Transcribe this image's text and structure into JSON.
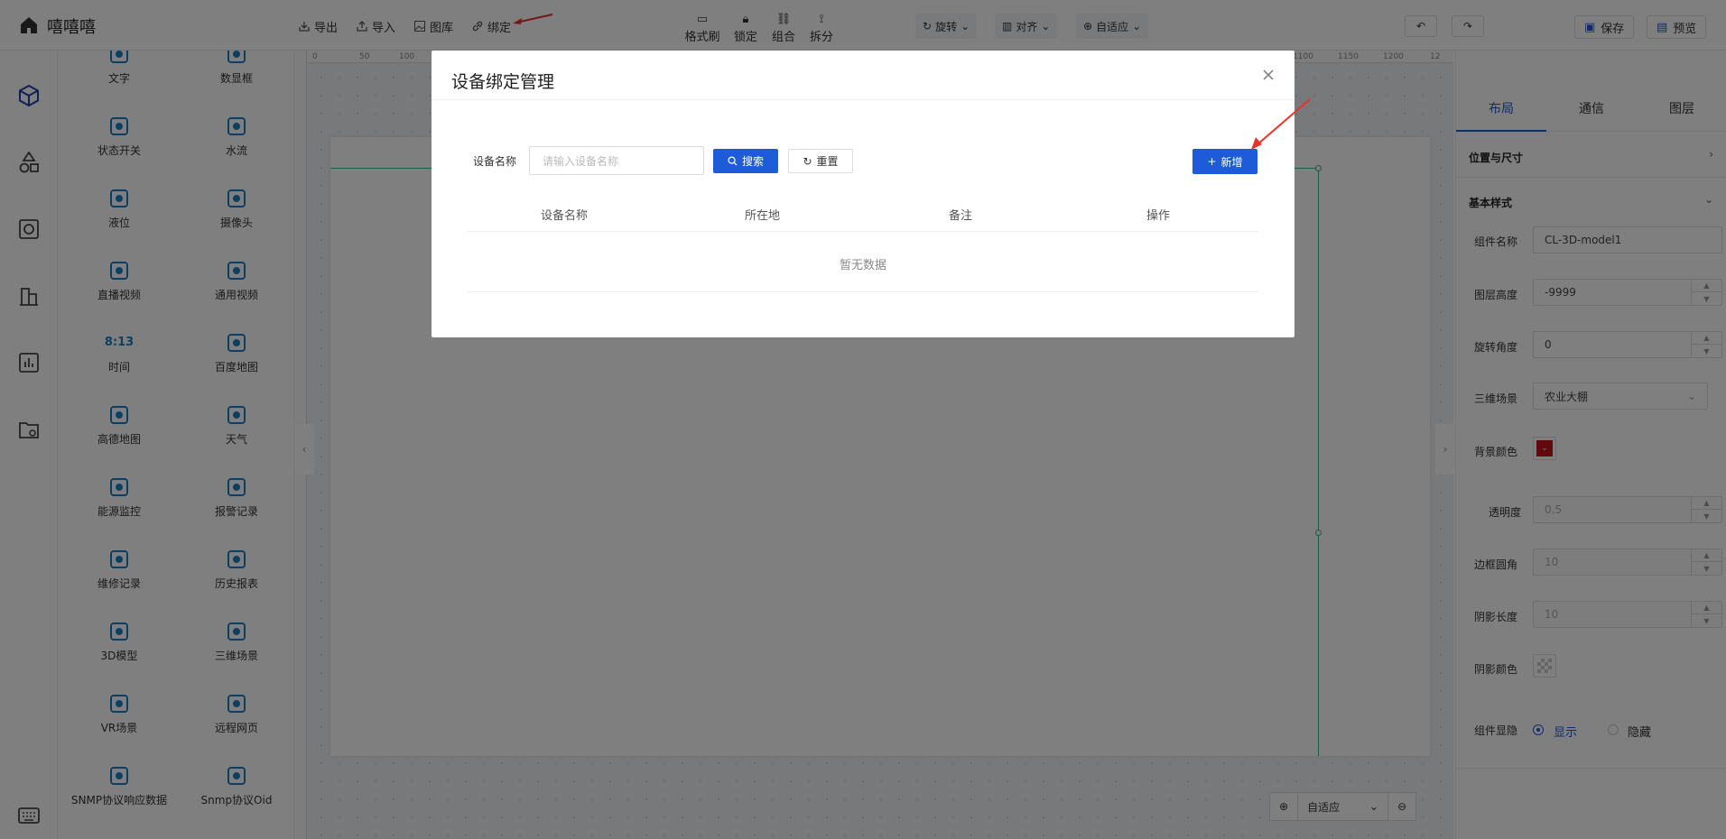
{
  "app": {
    "name": "嘻嘻嘻"
  },
  "toolbar": {
    "export": "导出",
    "import": "导入",
    "gallery": "图库",
    "bind": "绑定",
    "format_brush": "格式刷",
    "lock": "锁定",
    "group": "组合",
    "ungroup": "拆分",
    "rotate": "旋转",
    "align": "对齐",
    "adapt": "自适应",
    "save": "保存",
    "preview": "预览"
  },
  "components": [
    {
      "label": "文字",
      "icon": "text-icon"
    },
    {
      "label": "数显框",
      "icon": "number-display-icon"
    },
    {
      "label": "状态开关",
      "icon": "switch-icon"
    },
    {
      "label": "水流",
      "icon": "water-flow-icon"
    },
    {
      "label": "液位",
      "icon": "liquid-level-icon"
    },
    {
      "label": "摄像头",
      "icon": "camera-icon"
    },
    {
      "label": "直播视频",
      "icon": "live-video-icon"
    },
    {
      "label": "通用视频",
      "icon": "video-icon"
    },
    {
      "label": "时间",
      "icon": "time-icon",
      "glyph": "8:13"
    },
    {
      "label": "百度地图",
      "icon": "map-icon"
    },
    {
      "label": "高德地图",
      "icon": "map-icon"
    },
    {
      "label": "天气",
      "icon": "weather-icon"
    },
    {
      "label": "能源监控",
      "icon": "energy-monitor-icon"
    },
    {
      "label": "报警记录",
      "icon": "alarm-record-icon"
    },
    {
      "label": "维修记录",
      "icon": "repair-record-icon"
    },
    {
      "label": "历史报表",
      "icon": "history-report-icon"
    },
    {
      "label": "3D模型",
      "icon": "cube-icon"
    },
    {
      "label": "三维场景",
      "icon": "cube-icon"
    },
    {
      "label": "VR场景",
      "icon": "cube-icon"
    },
    {
      "label": "远程网页",
      "icon": "web-icon"
    },
    {
      "label": "SNMP协议响应数据",
      "icon": "snmp-icon"
    },
    {
      "label": "Snmp协议Oid",
      "icon": "snmp-icon"
    }
  ],
  "ruler": {
    "ticks": [
      "0",
      "50",
      "100",
      "1100",
      "1150",
      "1200",
      "12"
    ]
  },
  "zoom": {
    "value": "自适应"
  },
  "right_panel": {
    "tabs": [
      "布局",
      "通信",
      "图层"
    ],
    "section_position": "位置与尺寸",
    "section_basic": "基本样式",
    "fields": {
      "name_label": "组件名称",
      "name_value": "CL-3D-model1",
      "layer_label": "图层高度",
      "layer_value": "-9999",
      "rotate_label": "旋转角度",
      "rotate_value": "0",
      "scene_label": "三维场景",
      "scene_value": "农业大棚",
      "bg_label": "背景颜色",
      "bg_color": "#c0151b",
      "opacity_label": "透明度",
      "opacity_value": "0.5",
      "radius_label": "边框圆角",
      "radius_value": "10",
      "shadow_len_label": "阴影长度",
      "shadow_len_value": "10",
      "shadow_color_label": "阴影颜色",
      "visible_label": "组件显隐",
      "show": "显示",
      "hide": "隐藏"
    }
  },
  "modal": {
    "title": "设备绑定管理",
    "search_label": "设备名称",
    "search_placeholder": "请输入设备名称",
    "search_button": "搜索",
    "reset_button": "重置",
    "add_button": "新增",
    "columns": [
      "设备名称",
      "所在地",
      "备注",
      "操作"
    ],
    "empty_text": "暂无数据"
  },
  "colors": {
    "accent": "#1e5bd8",
    "guide": "#3bb38a",
    "annotation_arrow": "#e8332b",
    "icon_blue": "#1a7fc7"
  }
}
